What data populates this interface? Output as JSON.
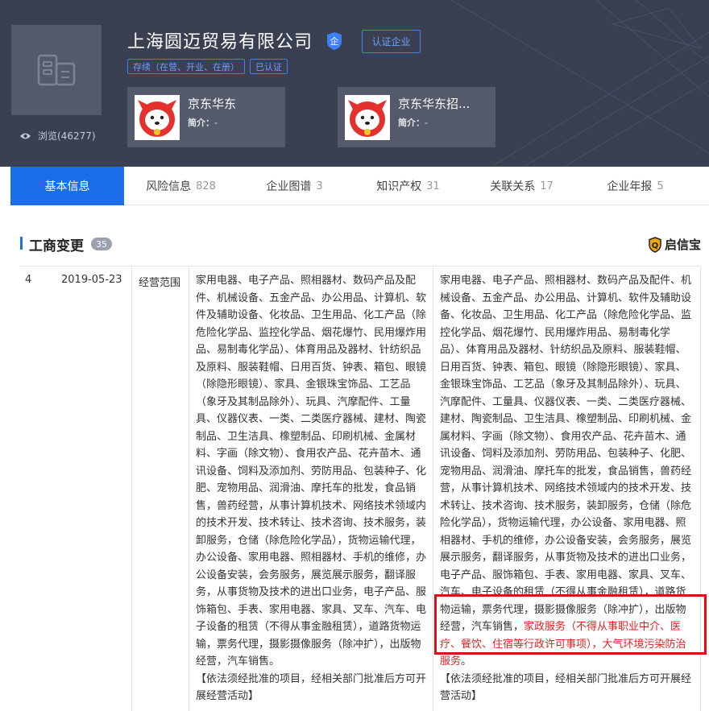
{
  "company": {
    "name": "上海圆迈贸易有限公司",
    "verify_label": "认证企业",
    "status_tags": [
      "存续（在营、开业、在册）",
      "已认证"
    ],
    "views_label": "浏览(46277)"
  },
  "brand_cards": [
    {
      "title": "京东华东",
      "desc_label": "简介：",
      "desc_value": "-"
    },
    {
      "title": "京东华东招...",
      "desc_label": "简介：",
      "desc_value": "-"
    }
  ],
  "tabs": [
    {
      "label": "基本信息",
      "count": ""
    },
    {
      "label": "风险信息",
      "count": "828"
    },
    {
      "label": "企业图谱",
      "count": "3"
    },
    {
      "label": "知识产权",
      "count": "31"
    },
    {
      "label": "关联关系",
      "count": "17"
    },
    {
      "label": "企业年报",
      "count": "5"
    }
  ],
  "section": {
    "title": "工商变更",
    "count": "35",
    "brand": "启信宝"
  },
  "record": {
    "index": "4",
    "date": "2019-05-23",
    "field": "经营范围",
    "before": "家用电器、电子产品、照相器材、数码产品及配件、机械设备、五金产品、办公用品、计算机、软件及辅助设备、化妆品、卫生用品、化工产品（除危险化学品、监控化学品、烟花爆竹、民用爆炸用品、易制毒化学品）、体育用品及器材、针纺织品及原料、服装鞋帽、日用百货、钟表、箱包、眼镜（除隐形眼镜）、家具、金银珠宝饰品、工艺品（象牙及其制品除外）、玩具、汽摩配件、工量具、仪器仪表、一类、二类医疗器械、建材、陶瓷制品、卫生洁具、橡塑制品、印刷机械、金属材料、字画（除文物）、食用农产品、花卉苗木、通讯设备、饲料及添加剂、劳防用品、包装种子、化肥、宠物用品、润滑油、摩托车的批发，食品销售，兽药经营，从事计算机技术、网络技术领域内的技术开发、技术转让、技术咨询、技术服务，装卸服务，仓储（除危险化学品），货物运输代理，办公设备、家用电器、照相器材、手机的维修，办公设备安装，会务服务，展览展示服务，翻译服务，从事货物及技术的进出口业务，电子产品、服饰箱包、手表、家用电器、家具、叉车、汽车、电子设备的租赁（不得从事金融租赁），道路货物运输，票务代理，摄影摄像服务（除冲扩），出版物经营，汽车销售。",
    "before_note": "【依法须经批准的项目，经相关部门批准后方可开展经营活动】",
    "after": "家用电器、电子产品、照相器材、数码产品及配件、机械设备、五金产品、办公用品、计算机、软件及辅助设备、化妆品、卫生用品、化工产品（除危险化学品、监控化学品、烟花爆竹、民用爆炸用品、易制毒化学品）、体育用品及器材、针纺织品及原料、服装鞋帽、日用百货、钟表、箱包、眼镜（除隐形眼镜）、家具、金银珠宝饰品、工艺品（象牙及其制品除外）、玩具、汽摩配件、工量具、仪器仪表、一类、二类医疗器械、建材、陶瓷制品、卫生洁具、橡塑制品、印刷机械、金属材料、字画（除文物）、食用农产品、花卉苗木、通讯设备、饲料及添加剂、劳防用品、包装种子、化肥、宠物用品、润滑油、摩托车的批发，食品销售，兽药经营，从事计算机技术、网络技术领域内的技术开发、技术转让、技术咨询、技术服务，装卸服务，仓储（除危险化学品），货物运输代理，办公设备、家用电器、照相器材、手机的维修，办公设备安装，会务服务，展览展示服务，翻译服务，从事货物及技术的进出口业务，电子产品、服饰箱包、手表、家用电器、家具、叉车、汽车、电子设备的租赁（不得从事金融租赁），道路货物运输，票务代理，摄影摄像服务（除冲扩），出版物经营，汽车销售，",
    "after_added": "家政服务（不得从事职业中介、医疗、餐饮、住宿等行政许可事项），大气环境污染防治服务",
    "after_end": "。",
    "after_note": "【依法须经批准的项目，经相关部门批准后方可开展经营活动】"
  },
  "colors": {
    "header_bg": "#3a3f52",
    "accent": "#1b6ee8",
    "highlight": "#e02020"
  }
}
